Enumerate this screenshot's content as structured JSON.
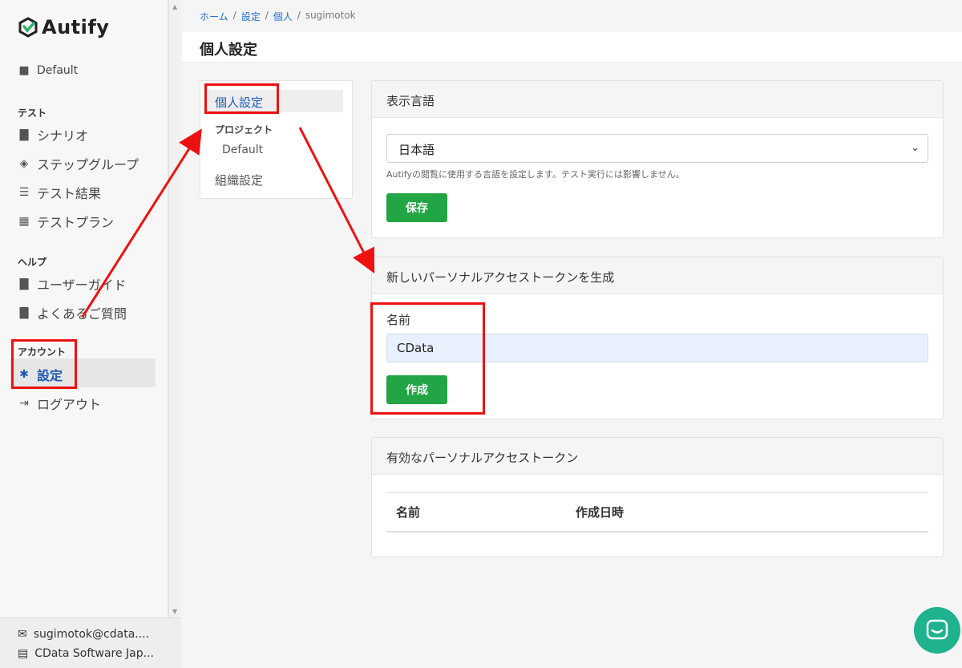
{
  "brand": {
    "name": "Autify"
  },
  "sidebar": {
    "project": "Default",
    "sections": {
      "test": "テスト",
      "help": "ヘルプ",
      "account": "アカウント"
    },
    "items": {
      "scenario": "シナリオ",
      "step_group": "ステップグループ",
      "test_results": "テスト結果",
      "test_plan": "テストプラン",
      "user_guide": "ユーザーガイド",
      "faq": "よくあるご質問",
      "settings": "設定",
      "logout": "ログアウト"
    },
    "footer": {
      "email": "sugimotok@cdata....",
      "org": "CData Software Jap..."
    }
  },
  "breadcrumb": {
    "home": "ホーム",
    "settings": "設定",
    "personal": "個人",
    "user": "sugimotok",
    "sep": "/"
  },
  "page": {
    "title": "個人設定"
  },
  "subnav": {
    "personal": "個人設定",
    "project_heading": "プロジェクト",
    "project_default": "Default",
    "org": "組織設定"
  },
  "language_card": {
    "title": "表示言語",
    "selected": "日本語",
    "help": "Autifyの閲覧に使用する言語を設定します。テスト実行には影響しません。",
    "save_label": "保存"
  },
  "token_create_card": {
    "title": "新しいパーソナルアクセストークンを生成",
    "name_label": "名前",
    "name_value": "CData",
    "create_label": "作成"
  },
  "tokens_card": {
    "title": "有効なパーソナルアクセストークン",
    "columns": [
      "名前",
      "作成日時"
    ]
  },
  "colors": {
    "accent": "#1d5ab5",
    "button": "#22a544",
    "annotation": "#ee1111",
    "chat": "#1fb28e"
  }
}
